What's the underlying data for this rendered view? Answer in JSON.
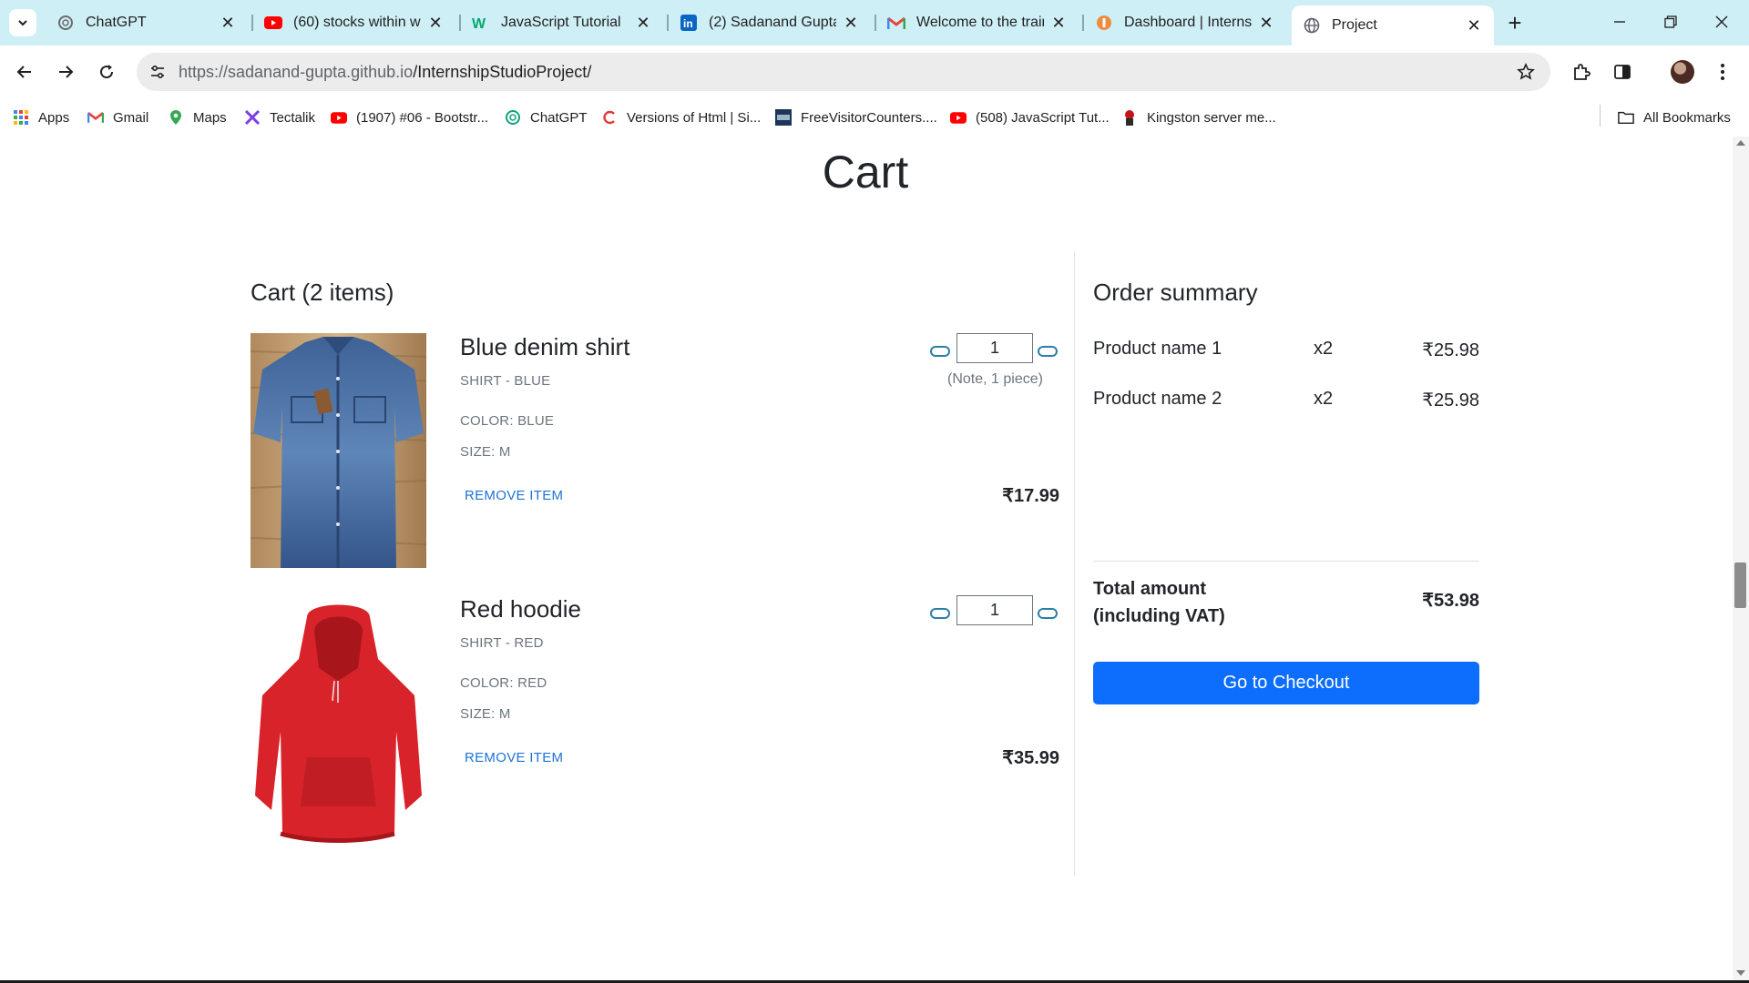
{
  "browser": {
    "tabs": [
      {
        "title": "ChatGPT",
        "icon": "chatgpt-icon"
      },
      {
        "title": "(60) stocks within we",
        "icon": "youtube-icon"
      },
      {
        "title": "JavaScript Tutorial",
        "icon": "w3schools-icon"
      },
      {
        "title": "(2) Sadanand Gupta",
        "icon": "linkedin-icon"
      },
      {
        "title": "Welcome to the train",
        "icon": "gmail-icon"
      },
      {
        "title": "Dashboard | Internsh",
        "icon": "internshala-icon"
      },
      {
        "title": "Project",
        "icon": "globe-icon",
        "active": true
      }
    ],
    "url_host": "https://sadanand-gupta.github.io",
    "url_path": "/InternshipStudioProject/",
    "bookmarks": [
      {
        "label": "Apps",
        "icon": "apps-grid-icon"
      },
      {
        "label": "Gmail",
        "icon": "gmail-icon"
      },
      {
        "label": "Maps",
        "icon": "maps-pin-icon"
      },
      {
        "label": "Tectalik",
        "icon": "tectalik-icon"
      },
      {
        "label": "(1907) #06 - Bootstr...",
        "icon": "youtube-icon"
      },
      {
        "label": "ChatGPT",
        "icon": "chatgpt-icon"
      },
      {
        "label": "Versions of Html | Si...",
        "icon": "versions-icon"
      },
      {
        "label": "FreeVisitorCounters....",
        "icon": "counter-icon"
      },
      {
        "label": "(508) JavaScript Tut...",
        "icon": "youtube-icon"
      },
      {
        "label": "Kingston server me...",
        "icon": "kingston-icon"
      }
    ],
    "all_bookmarks": "All Bookmarks"
  },
  "page": {
    "title": "Cart",
    "cart_heading": "Cart (2 items)",
    "items": [
      {
        "name": "Blue denim shirt",
        "subtitle": "SHIRT - BLUE",
        "color": "COLOR: BLUE",
        "size": "SIZE: M",
        "remove": "REMOVE ITEM",
        "quantity": "1",
        "note": "(Note, 1 piece)",
        "price": "₹17.99"
      },
      {
        "name": "Red hoodie",
        "subtitle": "SHIRT - RED",
        "color": "COLOR: RED",
        "size": "SIZE: M",
        "remove": "REMOVE ITEM",
        "quantity": "1",
        "price": "₹35.99"
      }
    ],
    "summary": {
      "title": "Order summary",
      "rows": [
        {
          "name": "Product name 1",
          "qty": "x2",
          "price": "₹25.98"
        },
        {
          "name": "Product name 2",
          "qty": "x2",
          "price": "₹25.98"
        }
      ],
      "total_label": "Total amount (including VAT)",
      "total_value": "₹53.98",
      "checkout_label": "Go to Checkout"
    }
  },
  "colors": {
    "tabstrip": "#cfeff6",
    "primary_button": "#0d6efd",
    "link": "#1e74d2",
    "qty_button_border": "#2a7fa8"
  }
}
